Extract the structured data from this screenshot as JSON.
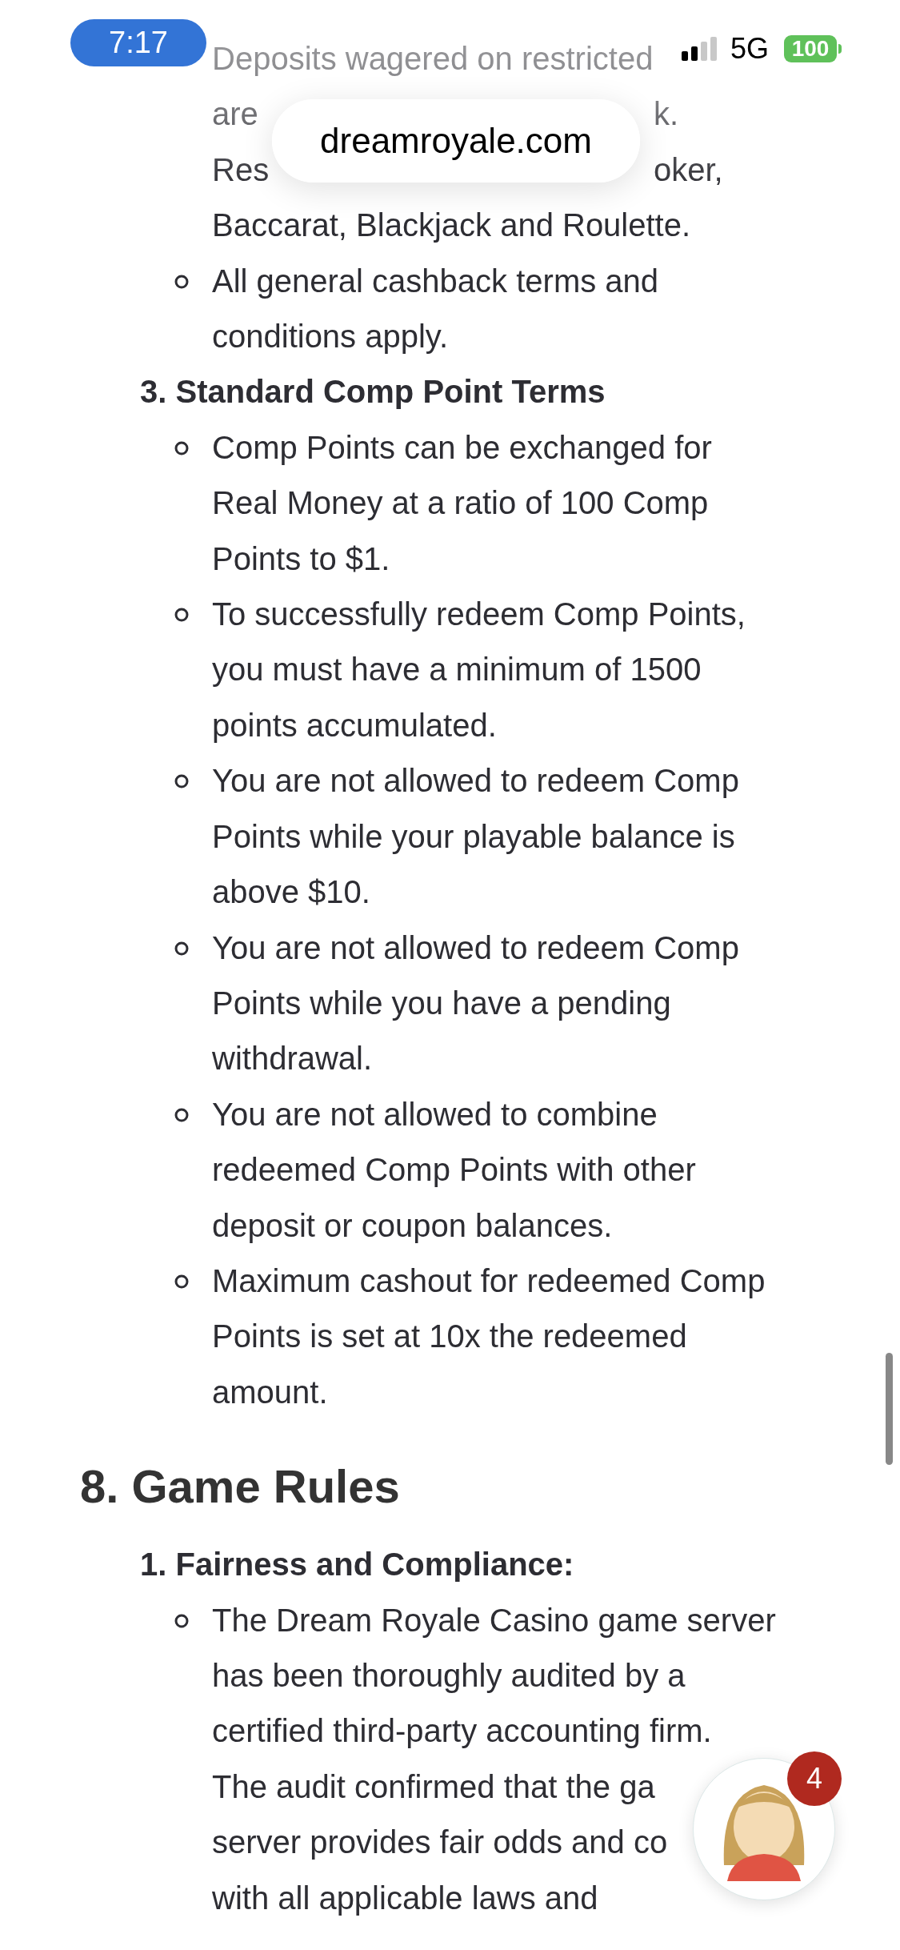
{
  "status_bar": {
    "time": "7:17",
    "network": "5G",
    "battery": "100"
  },
  "address_bar": {
    "url": "dreamroyale.com"
  },
  "content": [
    {
      "kind": "bullets",
      "items": [
        {
          "continued": true,
          "lines": [
            [
              "Deposits wagered on restricted"
            ],
            [
              "are",
              "k."
            ],
            [
              "Res",
              "oker,"
            ],
            [
              "Baccarat, Blackjack and Roulette."
            ]
          ]
        },
        {
          "lines": [
            [
              "All general cashback terms and"
            ],
            [
              "conditions apply."
            ]
          ]
        }
      ]
    },
    {
      "kind": "numbered",
      "text": "3. Standard Comp Point Terms"
    },
    {
      "kind": "bullets",
      "items": [
        {
          "lines": [
            [
              "Comp Points can be exchanged for"
            ],
            [
              "Real Money at a ratio of 100 Comp"
            ],
            [
              "Points to $1."
            ]
          ]
        },
        {
          "lines": [
            [
              "To successfully redeem Comp Points,"
            ],
            [
              "you must have a minimum of 1500"
            ],
            [
              "points accumulated."
            ]
          ]
        },
        {
          "lines": [
            [
              "You are not allowed to redeem Comp"
            ],
            [
              "Points while your playable balance is"
            ],
            [
              "above $10."
            ]
          ]
        },
        {
          "lines": [
            [
              "You are not allowed to redeem Comp"
            ],
            [
              "Points while you have a pending"
            ],
            [
              "withdrawal."
            ]
          ]
        },
        {
          "lines": [
            [
              "You are not allowed to combine"
            ],
            [
              "redeemed Comp Points with other"
            ],
            [
              "deposit or coupon balances."
            ]
          ]
        },
        {
          "lines": [
            [
              "Maximum cashout for redeemed Comp"
            ],
            [
              "Points is set at 10x the redeemed"
            ],
            [
              "amount."
            ]
          ]
        }
      ]
    },
    {
      "kind": "heading",
      "text": "8. Game Rules"
    },
    {
      "kind": "numbered",
      "text": "1. Fairness and Compliance:"
    },
    {
      "kind": "bullets",
      "items": [
        {
          "lines": [
            [
              "The Dream Royale Casino game server"
            ],
            [
              "has been thoroughly audited by a"
            ],
            [
              "certified third-party accounting firm."
            ],
            [
              "The audit confirmed that the ga"
            ],
            [
              "server provides fair odds and co"
            ],
            [
              "with all applicable laws and"
            ]
          ]
        }
      ]
    }
  ],
  "chat_button": {
    "badge": "4"
  }
}
